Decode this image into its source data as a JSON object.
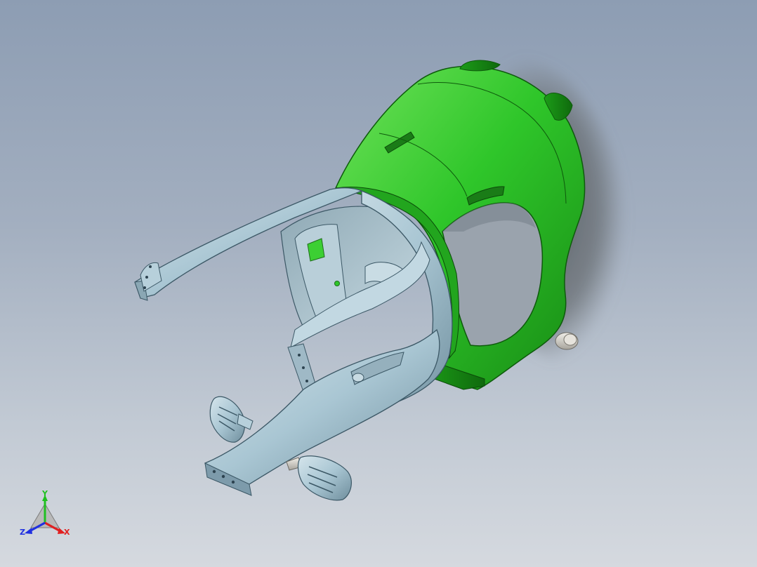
{
  "view": {
    "background_top": "#8d9db3",
    "background_bottom": "#d5d9df"
  },
  "model": {
    "green_part_color": "#2fc62a",
    "blue_part_color": "#a9c6d3",
    "grey_part_color": "#d7d4cc",
    "shadow_color": "#5f6469"
  },
  "triad": {
    "x_label": "X",
    "y_label": "Y",
    "z_label": "Z",
    "x_color": "#e02020",
    "y_color": "#20c020",
    "z_color": "#2030e0"
  }
}
